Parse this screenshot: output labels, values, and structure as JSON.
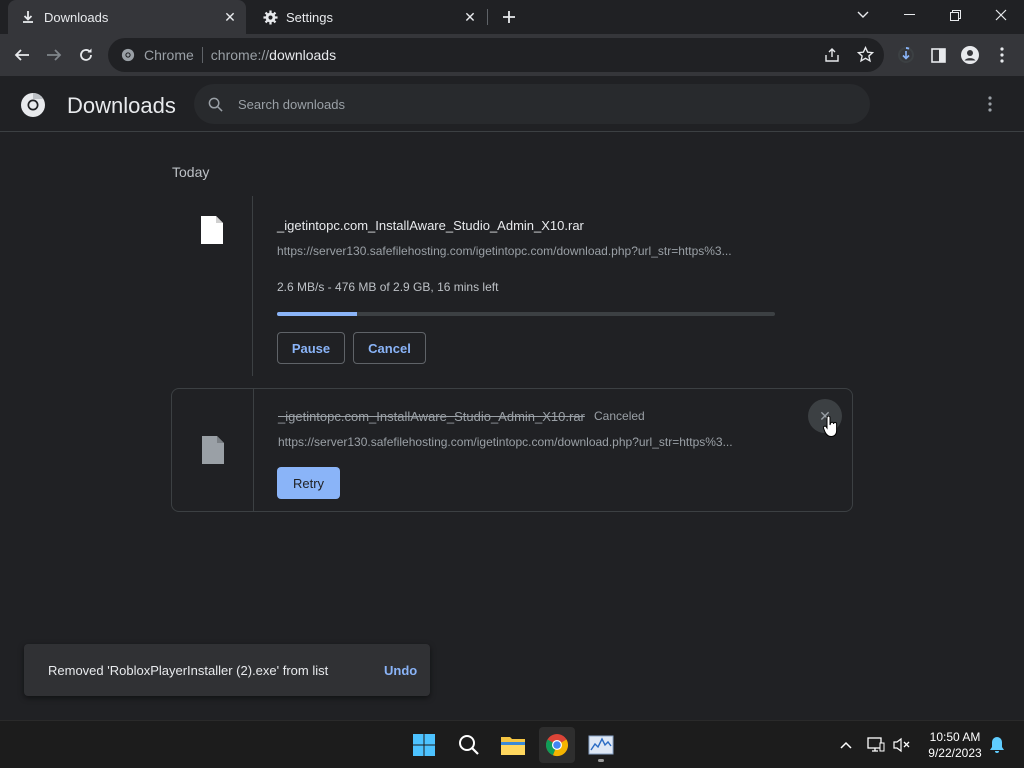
{
  "tabs": [
    {
      "title": "Downloads",
      "icon": "download-icon",
      "active": true
    },
    {
      "title": "Settings",
      "icon": "gear-icon",
      "active": false
    }
  ],
  "omnibox": {
    "chip": "Chrome",
    "scheme": "chrome://",
    "path": "downloads"
  },
  "header": {
    "title": "Downloads",
    "search_placeholder": "Search downloads"
  },
  "section": {
    "date": "Today"
  },
  "downloads": [
    {
      "name": "_igetintopc.com_InstallAware_Studio_Admin_X10.rar",
      "url": "https://server130.safefilehosting.com/igetintopc.com/download.php?url_str=https%3...",
      "status": "2.6 MB/s - 476 MB of 2.9 GB, 16 mins left",
      "progress": 0.16,
      "pause_label": "Pause",
      "cancel_label": "Cancel"
    },
    {
      "name": "_igetintopc.com_InstallAware_Studio_Admin_X10.rar",
      "state_label": "Canceled",
      "url": "https://server130.safefilehosting.com/igetintopc.com/download.php?url_str=https%3...",
      "retry_label": "Retry",
      "remove_glyph": "✕"
    }
  ],
  "toast": {
    "message": "Removed 'RobloxPlayerInstaller (2).exe' from list",
    "action": "Undo"
  },
  "taskbar": {
    "apps": [
      "start-icon",
      "search-icon",
      "file-explorer-icon",
      "chrome-icon",
      "system-monitor-icon"
    ],
    "clock": {
      "time": "10:50 AM",
      "date": "9/22/2023"
    }
  },
  "colors": {
    "accent": "#8ab4f8",
    "background": "#202124",
    "toolbar": "#35363a"
  }
}
